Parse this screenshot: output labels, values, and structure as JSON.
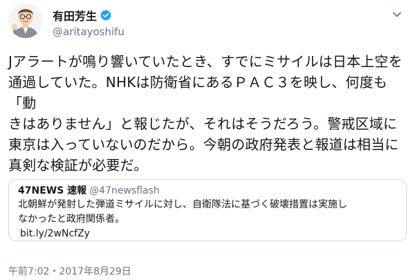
{
  "tweet": {
    "author": {
      "display_name": "有田芳生",
      "handle": "@aritayoshifu",
      "verified": true,
      "avatar_icon": "cartoon-avatar-icon"
    },
    "text_lines": [
      "Jアラートが鳴り響いていたとき、すでにミサイルは日本上空を",
      "通過していた。NHKは防衛省にあるＰＡＣ３を映し、何度も「動",
      "きはありません」と報じたが、それはそうだろう。警戒区域に",
      "東京は入っていないのだから。今朝の政府発表と報道は相当に",
      "真剣な検証が必要だ。"
    ],
    "quoted": {
      "name": "47NEWS 速報",
      "handle": "@47newsflash",
      "body_lines": [
        "北朝鮮が発射した弾道ミサイルに対し、自衛隊法に基づく破壊措置は実施し",
        "なかったと政府関係者。"
      ],
      "link": "bit.ly/2wNcfZy"
    },
    "timestamp": "午前7:02・2017年8月29日"
  },
  "colors": {
    "text": "#14171a",
    "secondary": "#657786",
    "border": "#ccd6dd",
    "verified_blue": "#1da1f2"
  }
}
